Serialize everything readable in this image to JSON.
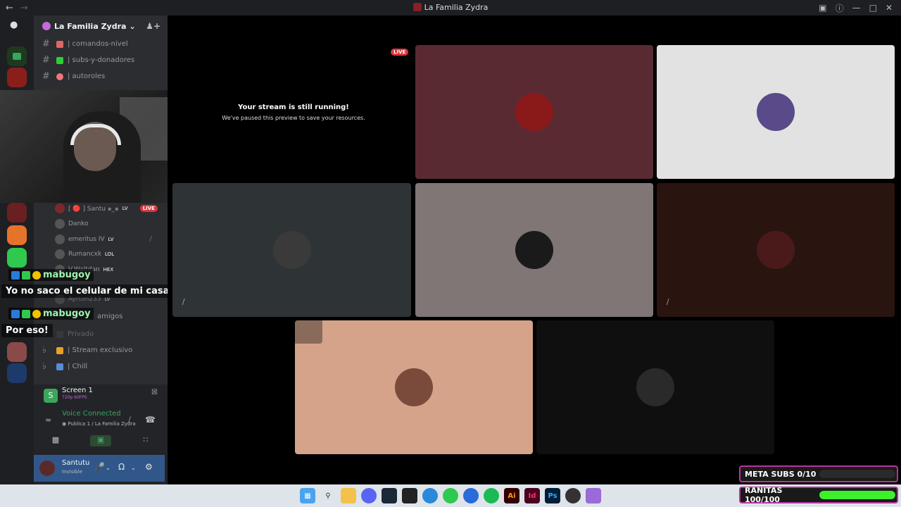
{
  "window": {
    "title": "La Familia Zydra"
  },
  "guild": {
    "name": "La Familia Zydra"
  },
  "channels": [
    {
      "name": "| comandos-nivel",
      "color": "#d66"
    },
    {
      "name": "| subs-y-donadores",
      "color": "#3c3"
    },
    {
      "name": "| autoroles",
      "color": "#e77"
    }
  ],
  "voice_users": [
    {
      "name": "[ 🔴 ] Santu ๑_๑",
      "badge": "LV",
      "live": "LIVE"
    },
    {
      "name": "Danko",
      "badge": ""
    },
    {
      "name": "emeritus IV",
      "badge": "LV"
    },
    {
      "name": "Rumancxk",
      "badge": "LOL"
    },
    {
      "name": "V.Waltdan",
      "badge": "HEX"
    },
    {
      "name": "Ayrton233",
      "badge": "LV"
    }
  ],
  "voice_channels": [
    {
      "name": "amigos"
    },
    {
      "name": "Privado"
    },
    {
      "name": "| Stream exclusivo"
    },
    {
      "name": "| Chill"
    }
  ],
  "chat": [
    {
      "user": "mabugoy",
      "message": "Yo no saco el celular de mi casa generalmente!"
    },
    {
      "user": "mabugoy",
      "message": "Por eso!"
    }
  ],
  "screenshare": {
    "label": "Screen 1",
    "sub": "720p 60FPS"
  },
  "voice": {
    "status": "Voice Connected",
    "location": "Publica 1 / La Familia Zydra"
  },
  "user": {
    "name": "Santutu",
    "status": "Invisible"
  },
  "stage": {
    "paused_title": "Your stream is still running!",
    "paused_sub": "We've paused this preview to save your resources.",
    "live_label": "LIVE"
  },
  "overlays": {
    "meta_subs": {
      "label": "META SUBS 0/10",
      "fraction": 0.0,
      "color": "#ff2fd1"
    },
    "ranitas": {
      "label": "RANITAS 100/100",
      "fraction": 1.0,
      "color": "#3cf02a"
    }
  },
  "taskbar_apps": [
    "start",
    "search",
    "files",
    "discord",
    "steam",
    "epic",
    "edge",
    "spotify-green",
    "app-blue",
    "spotify",
    "illustrator",
    "indesign",
    "photoshop",
    "obs",
    "app-purple"
  ]
}
